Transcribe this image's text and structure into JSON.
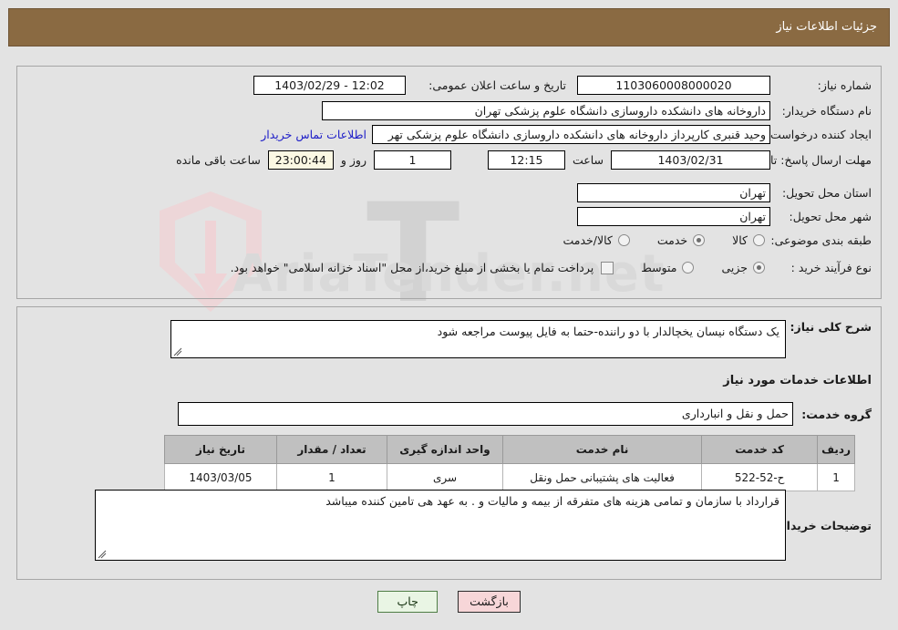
{
  "header": {
    "title": "جزئیات اطلاعات نیاز"
  },
  "form": {
    "need_number_label": "شماره نیاز:",
    "need_number_value": "1103060008000020",
    "announce_datetime_label": "تاریخ و ساعت اعلان عمومی:",
    "announce_datetime_value": "12:02 - 1403/02/29",
    "buyer_org_label": "نام دستگاه خریدار:",
    "buyer_org_value": "داروخانه های دانشکده داروسازی دانشگاه علوم پزشکی تهران",
    "requester_label": "ایجاد کننده درخواست:",
    "requester_value": "وحید قنبری کارپرداز داروخانه های دانشکده داروسازی دانشگاه علوم پزشکی تهر",
    "contact_link": "اطلاعات تماس خریدار",
    "deadline_label": "مهلت ارسال پاسخ: تا تاریخ:",
    "deadline_date": "1403/02/31",
    "hour_label": "ساعت",
    "deadline_time": "12:15",
    "remaining_days": "1",
    "days_and_label": "روز و",
    "remaining_clock": "23:00:44",
    "remaining_suffix": "ساعت باقی مانده",
    "province_label": "استان محل تحویل:",
    "province_value": "تهران",
    "city_label": "شهر محل تحویل:",
    "city_value": "تهران",
    "category_label": "طبقه بندی موضوعی:",
    "category_options": [
      {
        "label": "کالا",
        "selected": false
      },
      {
        "label": "خدمت",
        "selected": true
      },
      {
        "label": "کالا/خدمت",
        "selected": false
      }
    ],
    "process_label": "نوع فرآیند خرید :",
    "process_options": [
      {
        "label": "جزیی",
        "selected": true
      },
      {
        "label": "متوسط",
        "selected": false
      }
    ],
    "payment_checkbox_checked": false,
    "payment_note": "پرداخت تمام یا بخشی از مبلغ خرید،از محل \"اسناد خزانه اسلامی\" خواهد بود."
  },
  "main": {
    "general_desc_label": "شرح کلی نیاز:",
    "general_desc_value": "یک دستگاه نیسان یخچالدار با دو راننده-حتما به فایل پیوست مراجعه شود",
    "services_heading": "اطلاعات خدمات مورد نیاز",
    "service_group_label": "گروه خدمت:",
    "service_group_value": "حمل و نقل و انبارداری",
    "table": {
      "headers": [
        "ردیف",
        "کد خدمت",
        "نام خدمت",
        "واحد اندازه گیری",
        "تعداد / مقدار",
        "تاریخ نیاز"
      ],
      "rows": [
        {
          "row_no": "1",
          "service_code": "ح-52-522",
          "service_name": "فعالیت های پشتیبانی حمل ونقل",
          "unit": "سری",
          "quantity": "1",
          "need_date": "1403/03/05"
        }
      ]
    },
    "buyer_notes_label": "توضیحات خریدار:",
    "buyer_notes_value": "قرارداد با سازمان و تمامی هزینه های متفرقه از بیمه و مالیات و . به عهد هی تامین کننده میباشد"
  },
  "footer": {
    "print_label": "چاپ",
    "back_label": "بازگشت"
  },
  "watermark": {
    "text": "AriaTender.net"
  },
  "colors": {
    "header_bg": "#8a6a42",
    "link": "#2020c8",
    "cream_field": "#fbf8e3",
    "print_button": "#e9f5e4",
    "back_button": "#f7d6d8",
    "page_bg": "#e3e3e3"
  }
}
